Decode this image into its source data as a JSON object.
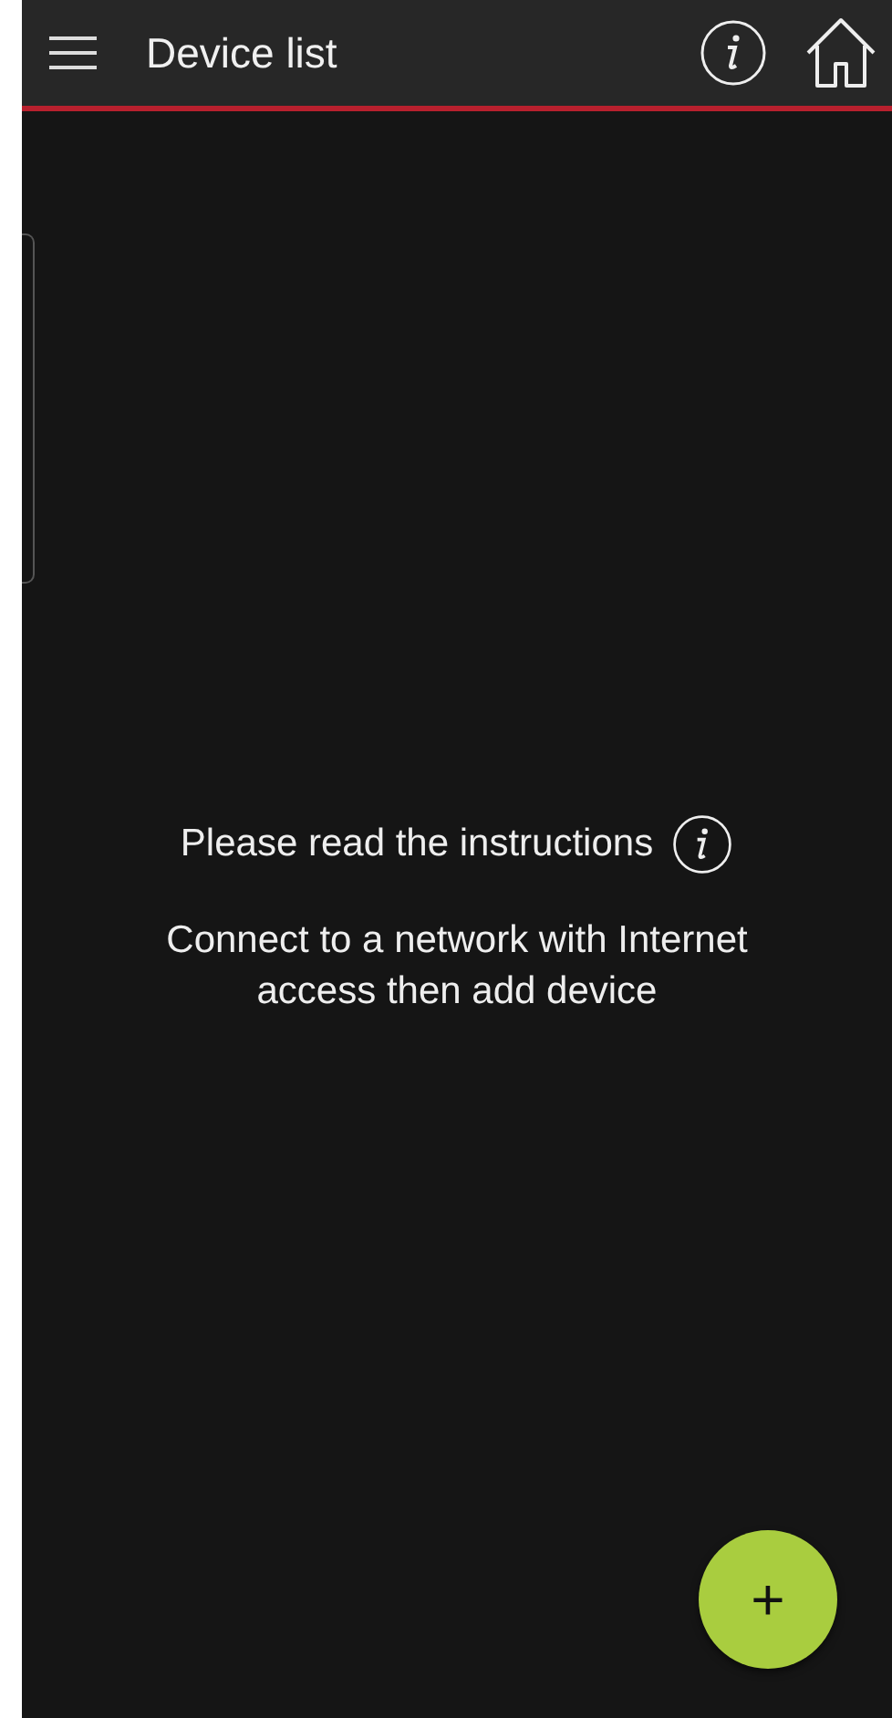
{
  "app_bar": {
    "title": "Device list"
  },
  "empty_state": {
    "instructions": "Please read the instructions",
    "message": "Connect to a network with Internet access then add device"
  },
  "fab": {
    "label": "+"
  }
}
